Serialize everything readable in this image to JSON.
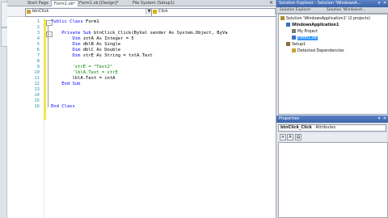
{
  "doc_tabs": [
    "Start Page",
    "Form1.vb*",
    "Form1.vb [Design]*",
    "File System (Setup1)"
  ],
  "nav": {
    "object_combo": "btnClick",
    "event_combo": "Click"
  },
  "code": {
    "line_numbers": [
      "1",
      "2",
      "3",
      "4",
      "5",
      "6",
      "7",
      "8",
      "9",
      "10",
      "11",
      "12",
      "13",
      "14",
      "15",
      "16"
    ],
    "lines": [
      {
        "kw": "Public Class",
        "rest": " Form1"
      },
      {
        "kw": "",
        "rest": ""
      },
      {
        "kw": "    Private Sub",
        "rest": " btnClick_Click(ByVal sender As System.Object, ByVa"
      },
      {
        "kw": "        Dim",
        "rest": " intA As Integer = 5"
      },
      {
        "kw": "        Dim",
        "rest": " dblB As Single"
      },
      {
        "kw": "        Dim",
        "rest": " dblC As Double"
      },
      {
        "kw": "        Dim",
        "rest": " strE As String = txtA.Text"
      },
      {
        "kw": "",
        "rest": ""
      },
      {
        "kw": "",
        "cm": "        'strE = \"Test2\""
      },
      {
        "kw": "",
        "cm": "        'lblA.Text = strE"
      },
      {
        "kw": "",
        "rest": "        lblA.Text = intA"
      },
      {
        "kw": "    End Sub",
        "rest": ""
      },
      {
        "kw": "",
        "rest": ""
      },
      {
        "kw": "",
        "rest": ""
      },
      {
        "kw": "",
        "rest": ""
      },
      {
        "kw": "End Class",
        "rest": ""
      }
    ]
  },
  "solution_explorer": {
    "title": "Solution Explorer - Solution 'WindowsA...",
    "tabs": [
      "Solution Explorer",
      "Solution 'WindowsA..."
    ],
    "nodes": [
      {
        "label": "Solution 'WindowsApplication1' (2 projects)",
        "indent": 0,
        "bold": false
      },
      {
        "label": "WindowsApplication1",
        "indent": 1,
        "bold": true
      },
      {
        "label": "My Project",
        "indent": 2,
        "bold": false
      },
      {
        "label": "Form1.vb",
        "indent": 2,
        "bold": false,
        "selected": true
      },
      {
        "label": "Setup1",
        "indent": 1,
        "bold": false
      },
      {
        "label": "Detected Dependencies",
        "indent": 2,
        "bold": false
      }
    ]
  },
  "properties": {
    "title": "Properties",
    "selected_object": "btnClick_Click",
    "selected_type": "Attributes"
  },
  "colors": {
    "keyword": "#0000ff",
    "comment": "#008000",
    "line_number": "#2b91af",
    "panel_title": "#3c63a8"
  }
}
